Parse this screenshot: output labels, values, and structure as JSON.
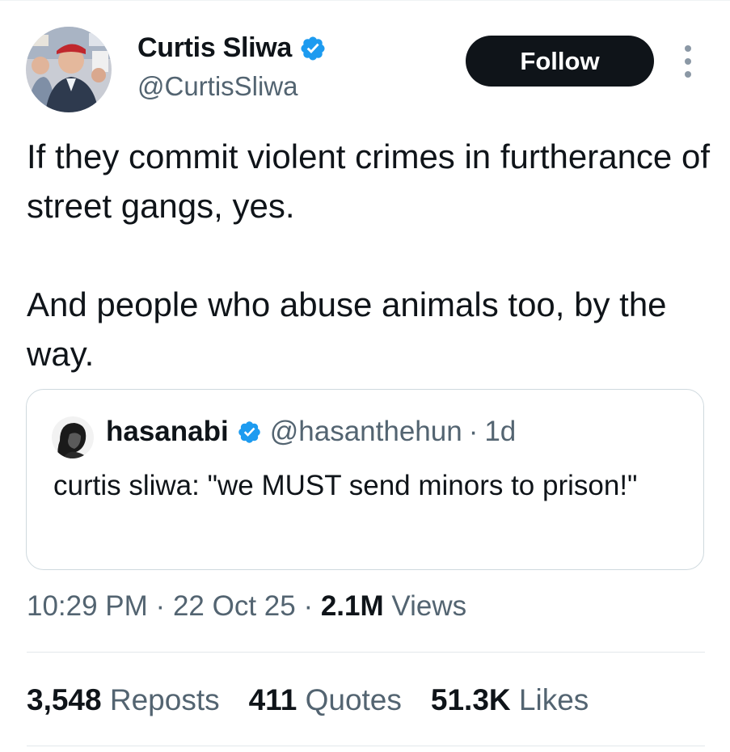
{
  "tweet": {
    "author": {
      "name": "Curtis Sliwa",
      "handle": "@CurtisSliwa",
      "verified": true
    },
    "follow_label": "Follow",
    "text": "If they commit violent crimes in furtherance of street gangs, yes.\n\nAnd people who abuse animals too, by the way.",
    "quoted": {
      "name": "hasanabi",
      "handle": "@hasanthehun",
      "separator": "·",
      "age": "1d",
      "verified": true,
      "text": "curtis sliwa: \"we MUST send minors to prison!\""
    },
    "meta": {
      "time": "10:29 PM",
      "separator": "·",
      "date": "22 Oct 25",
      "views_count": "2.1M",
      "views_label": "Views"
    },
    "stats": [
      {
        "count": "3,548",
        "label": "Reposts"
      },
      {
        "count": "411",
        "label": "Quotes"
      },
      {
        "count": "51.3K",
        "label": "Likes"
      }
    ]
  },
  "icons": {
    "verified": "verified-badge-icon",
    "more": "more-options-icon"
  },
  "colors": {
    "text": "#0f1419",
    "secondary": "#536471",
    "verified_blue": "#1d9bf0",
    "follow_bg": "#0f1419",
    "border": "#cfd9de"
  }
}
